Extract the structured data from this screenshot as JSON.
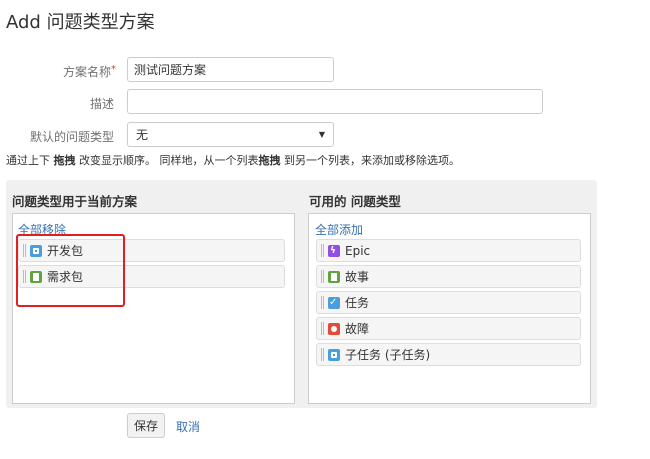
{
  "page": {
    "title": "Add 问题类型方案"
  },
  "form": {
    "name_label": "方案名称",
    "required_mark": "*",
    "name_value": "测试问题方案",
    "desc_label": "描述",
    "desc_value": "",
    "default_label": "默认的问题类型",
    "default_value": "无"
  },
  "help": {
    "part1": "通过上下 ",
    "bold1": "拖拽",
    "part2": " 改变显示顺序。 同样地，从一个列表",
    "bold2": "拖拽",
    "part3": " 到另一个列表，来添加或移除选项。"
  },
  "current": {
    "title": "问题类型用于当前方案",
    "remove_all": "全部移除",
    "items": [
      {
        "label": "开发包",
        "icon": "dev-package-icon",
        "color": "#4a9fdb"
      },
      {
        "label": "需求包",
        "icon": "story-icon",
        "color": "#63a33f"
      }
    ]
  },
  "available": {
    "title": "可用的 问题类型",
    "add_all": "全部添加",
    "items": [
      {
        "label": "Epic",
        "icon": "epic-icon",
        "color": "#904ee2"
      },
      {
        "label": "故事",
        "icon": "story-icon",
        "color": "#63a33f"
      },
      {
        "label": "任务",
        "icon": "task-icon",
        "color": "#4a9fdb"
      },
      {
        "label": "故障",
        "icon": "bug-icon",
        "color": "#e5493a"
      },
      {
        "label": "子任务 (子任务)",
        "icon": "subtask-icon",
        "color": "#4a9fdb"
      }
    ]
  },
  "actions": {
    "save": "保存",
    "cancel": "取消"
  }
}
